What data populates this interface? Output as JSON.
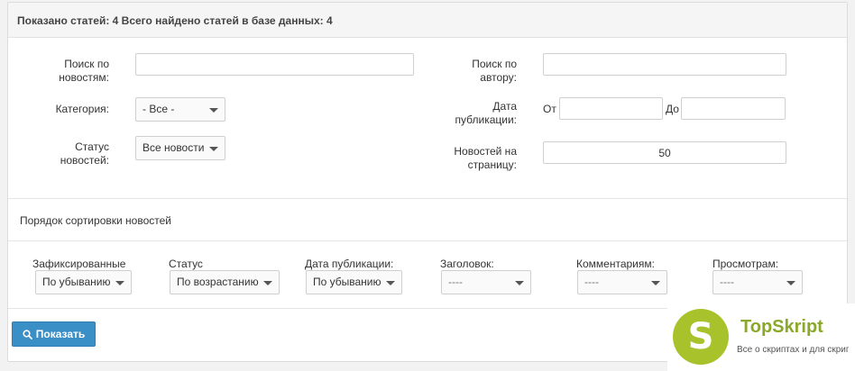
{
  "header": {
    "title": "Показано статей: 4 Всего найдено статей в базе данных: 4"
  },
  "filters": {
    "search_news_label": "Поиск по новостям:",
    "search_news_value": "",
    "category_label": "Категория:",
    "category_value": "- Все -",
    "status_label": "Статус новостей:",
    "status_value": "Все новости",
    "search_author_label": "Поиск по автору:",
    "search_author_value": "",
    "date_label": "Дата публикации:",
    "date_from_label": "От",
    "date_to_label": "До",
    "per_page_label": "Новостей на страницу:",
    "per_page_value": "50"
  },
  "sort": {
    "title": "Порядок сортировки новостей",
    "fields": [
      {
        "label": "Зафиксированные",
        "value": "По убыванию"
      },
      {
        "label": "Статус",
        "value": "По возрастанию"
      },
      {
        "label": "Дата публикации:",
        "value": "По убыванию"
      },
      {
        "label": "Заголовок:",
        "value": "----"
      },
      {
        "label": "Комментариям:",
        "value": "----"
      },
      {
        "label": "Просмотрам:",
        "value": "----"
      }
    ]
  },
  "actions": {
    "show_label": "Показать"
  },
  "brand": {
    "logo_letter": "S",
    "name": "TopSkript",
    "tagline": "Все о скриптах и для скриптов..."
  },
  "colors": {
    "primary_button": "#3a8fc7",
    "brand": "#a7c22a"
  }
}
